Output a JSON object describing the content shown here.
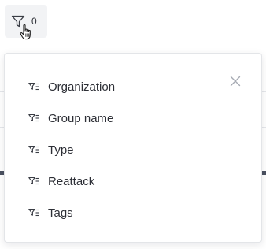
{
  "filter_button": {
    "icon": "funnel-icon",
    "count": "0"
  },
  "popover": {
    "close_icon": "close-icon",
    "options": [
      {
        "label": "Organization",
        "icon": "filter-list-icon"
      },
      {
        "label": "Group name",
        "icon": "filter-list-icon"
      },
      {
        "label": "Type",
        "icon": "filter-list-icon"
      },
      {
        "label": "Reattack",
        "icon": "filter-list-icon"
      },
      {
        "label": "Tags",
        "icon": "filter-list-icon"
      }
    ]
  },
  "colors": {
    "text": "#2d2f36",
    "button_bg": "#f2f3f5",
    "close_icon": "#a6aab3",
    "border": "#e3e5e8"
  }
}
